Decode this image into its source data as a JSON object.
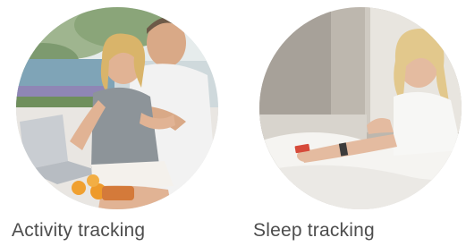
{
  "features": [
    {
      "id": "activity",
      "icon": "activity-photo",
      "caption": "Activity tracking"
    },
    {
      "id": "sleep",
      "icon": "sleep-photo",
      "caption": "Sleep tracking"
    }
  ],
  "colors": {
    "caption_text": "#4d4d4d",
    "background": "#ffffff"
  }
}
